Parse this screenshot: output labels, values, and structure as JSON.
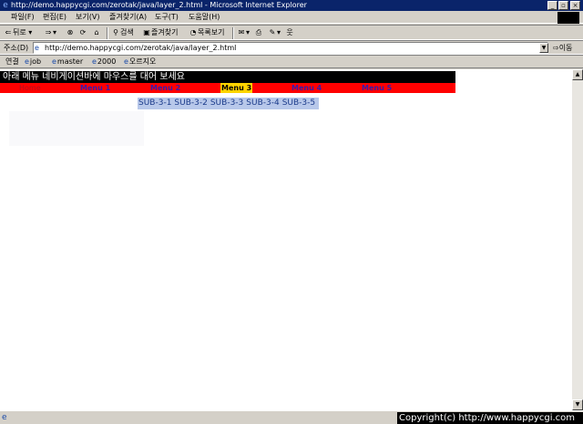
{
  "window": {
    "title": "http://demo.happycgi.com/zerotak/java/layer_2.html - Microsoft Internet Explorer"
  },
  "menubar": [
    "파일(F)",
    "편집(E)",
    "보기(V)",
    "즐겨찾기(A)",
    "도구(T)",
    "도움말(H)"
  ],
  "toolbar": {
    "back": "뒤로",
    "search": "검색",
    "favorites": "즐겨찾기",
    "history": "목록보기"
  },
  "address": {
    "label": "주소(D)",
    "url": "http://demo.happycgi.com/zerotak/java/layer_2.html",
    "go": "이동"
  },
  "links": {
    "label": "연결",
    "items": [
      "job",
      "master",
      "2000",
      "오르지오"
    ]
  },
  "page": {
    "header": "아래 메뉴 네비게이션바에 마우스를 대어 보세요",
    "nav": [
      "Home",
      "Menu 1",
      "Menu 2",
      "Menu 3",
      "Menu 4",
      "Menu 5"
    ],
    "active_nav": "Menu 3",
    "submenu": [
      "SUB-3-1",
      "SUB-3-2",
      "SUB-3-3",
      "SUB-3-4",
      "SUB-3-5"
    ]
  },
  "status": {
    "copyright": "Copyright(c) http://www.happycgi.com"
  },
  "colors": {
    "titlebar": "#0a246a",
    "nav_bg": "#ff0000",
    "nav_active": "#ffd400",
    "submenu_bg": "#b8c8ea"
  }
}
